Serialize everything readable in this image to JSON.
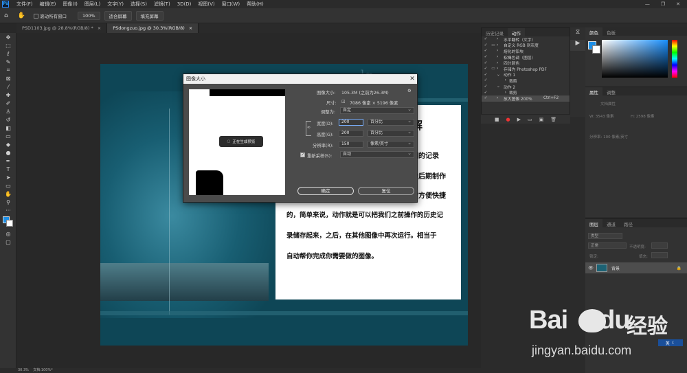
{
  "menubar": {
    "logo": "Ps",
    "items": [
      "文件(F)",
      "编辑(E)",
      "图像(I)",
      "图层(L)",
      "文字(Y)",
      "选择(S)",
      "滤镜(T)",
      "3D(D)",
      "视图(V)",
      "窗口(W)",
      "帮助(H)"
    ],
    "min": "—",
    "max": "❐",
    "close": "✕"
  },
  "options": {
    "scroll_all": "滚动所有窗口",
    "zoom": "100%",
    "fit_screen": "适合屏幕",
    "fill_screen": "填充屏幕"
  },
  "tabs": [
    {
      "label": "PSD1103.jpg @ 28.8%(RGB/8) *",
      "close": "×"
    },
    {
      "label": "PSdongzuo.jpg @ 30.3%(RGB/8)",
      "close": "×"
    }
  ],
  "status": {
    "zoom": "30.3%",
    "doc": "文档:100%*"
  },
  "history_panel": {
    "tabs": [
      "历史记录",
      "动作"
    ],
    "actions": [
      {
        "label": "水平翻转（文字）"
      },
      {
        "label": "自定义 RGB 到灰度"
      },
      {
        "label": "熔化的铅块"
      },
      {
        "label": "棕褐色调（图层）"
      },
      {
        "label": "四分颜色"
      },
      {
        "label": "存储为 Photoshop PDF"
      },
      {
        "label": "动作 1"
      },
      {
        "label": "裁剪"
      },
      {
        "label": "动作 2"
      },
      {
        "label": "裁剪"
      },
      {
        "label": "放大图像 200%",
        "shortcut": "Ctrl+F2"
      }
    ],
    "footer": [
      "■",
      "●",
      "▶",
      "▭",
      "▣",
      "🗑"
    ]
  },
  "color_panel": {
    "tabs": [
      "颜色",
      "色板"
    ],
    "fg": "#1d8fe6",
    "bg": "#ffffff"
  },
  "properties_panel": {
    "tabs": [
      "属性",
      "调整"
    ],
    "doc_props": "文档属性",
    "w": "W: 3543 像素",
    "h": "H: 2598 像素",
    "res": "分辨率: 100 像素/英寸"
  },
  "layers_panel": {
    "tabs": [
      "图层",
      "通道",
      "路径"
    ],
    "kind": "类型",
    "mode": "正常",
    "opacity": "不透明度:",
    "lock": "锁定:",
    "fill": "填充:",
    "layer_name": "背景"
  },
  "document": {
    "decor_title": "... ...  ...  ... ...lg",
    "text_lines": [
      "解",
      "细的记录",
      "的后期制作",
      "常方便快捷",
      "的，简单来说，动作就是可以把我们之前操作的历史记",
      "录储存起来，之后，在其他图像中再次运行。相当于",
      "自动帮你完成你需要做的图像。"
    ]
  },
  "dialog": {
    "title": "图像大小",
    "close": "✕",
    "preview_toast": "正在生成预览",
    "image_size_label": "图像大小:",
    "image_size_value": "105.3M (之前为26.3M)",
    "dimensions_label": "尺寸:",
    "dimensions_value": "7086 像素 × 5196 像素",
    "fit_label": "调整为:",
    "fit_value": "自定",
    "width_label": "宽度(D):",
    "width_value": "200",
    "width_unit": "百分比",
    "height_label": "高度(G):",
    "height_value": "200",
    "height_unit": "百分比",
    "res_label": "分辨率(R):",
    "res_value": "150",
    "res_unit": "像素/英寸",
    "resample_label": "重新采样(S):",
    "resample_value": "自动",
    "ok": "确定",
    "reset": "复位"
  },
  "watermark": {
    "brand": "Bai",
    "brand2": "du",
    "cn": "经验",
    "url": "jingyan.baidu.com"
  },
  "ime": {
    "label": "英"
  }
}
